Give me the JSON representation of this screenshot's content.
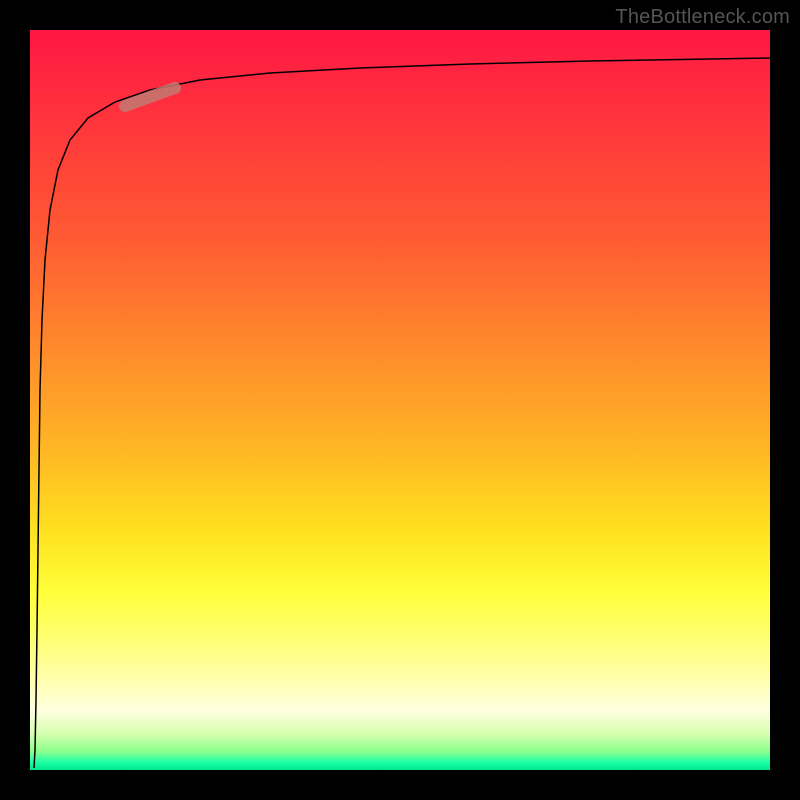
{
  "watermark": "TheBottleneck.com",
  "chart_data": {
    "type": "line",
    "title": "",
    "xlabel": "",
    "ylabel": "",
    "xlim": [
      0,
      100
    ],
    "ylim": [
      0,
      100
    ],
    "grid": false,
    "legend": false,
    "background_gradient": {
      "direction": "vertical",
      "stops": [
        {
          "pos": 0.0,
          "color": "#ff1744"
        },
        {
          "pos": 0.5,
          "color": "#ffbb24"
        },
        {
          "pos": 0.78,
          "color": "#ffff3a"
        },
        {
          "pos": 0.93,
          "color": "#ffffe0"
        },
        {
          "pos": 1.0,
          "color": "#00e68a"
        }
      ]
    },
    "series": [
      {
        "name": "curve",
        "x": [
          0.5,
          0.8,
          1.0,
          1.3,
          1.7,
          2.2,
          3.0,
          4.0,
          5.5,
          8.0,
          12,
          18,
          28,
          40,
          55,
          70,
          85,
          100
        ],
        "y": [
          0,
          20,
          40,
          55,
          65,
          73,
          80,
          84,
          87,
          89.5,
          91,
          92,
          93,
          93.7,
          94.2,
          94.6,
          94.9,
          95.2
        ]
      }
    ],
    "marker": {
      "x": 15,
      "y": 91.5
    }
  }
}
